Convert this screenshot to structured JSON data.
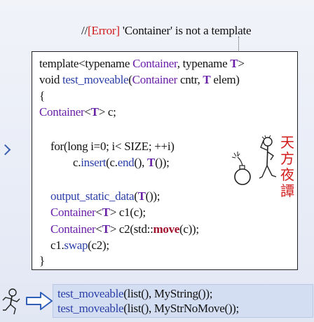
{
  "annotation": {
    "prefix": "//",
    "error_tag": "[Error]",
    "message": " 'Container' is not a template"
  },
  "code_lines": [
    {
      "tokens": [
        {
          "t": "template<typename ",
          "c": ""
        },
        {
          "t": "Container",
          "c": "kw"
        },
        {
          "t": ", typename ",
          "c": ""
        },
        {
          "t": "T",
          "c": "tp"
        },
        {
          "t": ">",
          "c": ""
        }
      ]
    },
    {
      "tokens": [
        {
          "t": "void ",
          "c": ""
        },
        {
          "t": "test_moveable",
          "c": "fn"
        },
        {
          "t": "(",
          "c": ""
        },
        {
          "t": "Container",
          "c": "kw"
        },
        {
          "t": " cntr, ",
          "c": ""
        },
        {
          "t": "T",
          "c": "tp"
        },
        {
          "t": " elem)",
          "c": ""
        }
      ]
    },
    {
      "tokens": [
        {
          "t": "{",
          "c": ""
        }
      ]
    },
    {
      "tokens": [
        {
          "t": "Container",
          "c": "kw"
        },
        {
          "t": "<",
          "c": ""
        },
        {
          "t": "T",
          "c": "tp"
        },
        {
          "t": "> c;",
          "c": ""
        }
      ]
    },
    {
      "tokens": [
        {
          "t": "for(long i=0; i< SIZE; ++i)",
          "c": ""
        }
      ]
    },
    {
      "tokens": [
        {
          "t": "c.",
          "c": ""
        },
        {
          "t": "insert",
          "c": "fn"
        },
        {
          "t": "(c.",
          "c": ""
        },
        {
          "t": "end",
          "c": "fn"
        },
        {
          "t": "(), ",
          "c": ""
        },
        {
          "t": "T",
          "c": "tp"
        },
        {
          "t": "());",
          "c": ""
        }
      ]
    },
    {
      "tokens": [
        {
          "t": "output_static_data",
          "c": "fn"
        },
        {
          "t": "(",
          "c": ""
        },
        {
          "t": "T",
          "c": "tp"
        },
        {
          "t": "());",
          "c": ""
        }
      ]
    },
    {
      "tokens": [
        {
          "t": "Container",
          "c": "kw"
        },
        {
          "t": "<",
          "c": ""
        },
        {
          "t": "T",
          "c": "tp"
        },
        {
          "t": "> c1(c);",
          "c": ""
        }
      ]
    },
    {
      "tokens": [
        {
          "t": "Container",
          "c": "kw"
        },
        {
          "t": "<",
          "c": ""
        },
        {
          "t": "T",
          "c": "tp"
        },
        {
          "t": "> c2(std::",
          "c": ""
        },
        {
          "t": "move",
          "c": "kwr"
        },
        {
          "t": "(c));",
          "c": ""
        }
      ]
    },
    {
      "tokens": [
        {
          "t": "c1.",
          "c": ""
        },
        {
          "t": "swap",
          "c": "fn"
        },
        {
          "t": "(c2);",
          "c": ""
        }
      ]
    },
    {
      "tokens": [
        {
          "t": "}",
          "c": ""
        }
      ]
    }
  ],
  "stamp_chars": [
    "天",
    "方",
    "夜",
    "譚"
  ],
  "calls": [
    {
      "tokens": [
        {
          "t": "test_moveable",
          "c": "fn"
        },
        {
          "t": "(list(), MyString());",
          "c": ""
        }
      ]
    },
    {
      "tokens": [
        {
          "t": "test_moveable",
          "c": "fn"
        },
        {
          "t": "(list(), MyStrNoMove());",
          "c": ""
        }
      ]
    }
  ],
  "icons": {
    "thinking_figure": "thinking-person-icon",
    "bomb": "bomb-icon",
    "runner": "running-person-icon",
    "arrow": "right-arrow-icon",
    "left_chevron": "chevron-right-icon"
  },
  "colors": {
    "keyword_purple": "#6a1fa8",
    "function_blue": "#2b3fa8",
    "move_red": "#a0112b",
    "error_red": "#d11a1a",
    "strip_blue": "#d4def3"
  }
}
